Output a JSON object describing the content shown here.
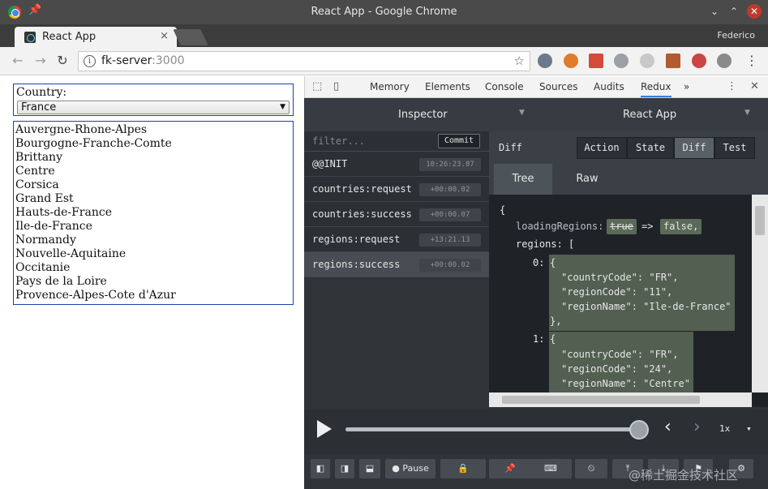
{
  "window": {
    "title": "React App - Google Chrome"
  },
  "browser": {
    "tab_label": "React App",
    "tab_close": "×",
    "profile_name": "Federico",
    "address": {
      "host": "fk-server",
      "port": ":3000"
    },
    "info_glyph": "i",
    "star_glyph": "☆"
  },
  "app": {
    "country_label": "Country:",
    "country_selected": "France",
    "regions": [
      "Auvergne-Rhone-Alpes",
      "Bourgogne-Franche-Comte",
      "Brittany",
      "Centre",
      "Corsica",
      "Grand Est",
      "Hauts-de-France",
      "Ile-de-France",
      "Normandy",
      "Nouvelle-Aquitaine",
      "Occitanie",
      "Pays de la Loire",
      "Provence-Alpes-Cote d'Azur"
    ]
  },
  "devtools": {
    "tabs": [
      "Memory",
      "Elements",
      "Console",
      "Sources",
      "Audits",
      "Redux"
    ],
    "active_tab": "Redux",
    "more": "»",
    "redux": {
      "left_header": "Inspector",
      "right_header": "React App",
      "filter_placeholder": "filter...",
      "commit_label": "Commit",
      "actions": [
        {
          "name": "@@INIT",
          "time": "10:26:23.87"
        },
        {
          "name": "countries:request",
          "time": "+00:00.02"
        },
        {
          "name": "countries:success",
          "time": "+00:00.07"
        },
        {
          "name": "regions:request",
          "time": "+13:21.13"
        },
        {
          "name": "regions:success",
          "time": "+00:00.02"
        }
      ],
      "selected_action": "regions:success",
      "panel_title": "Diff",
      "mode_buttons": [
        "Action",
        "State",
        "Diff",
        "Test"
      ],
      "active_mode": "Diff",
      "sub_tabs": [
        "Tree",
        "Raw"
      ],
      "active_sub_tab": "Tree",
      "diff": {
        "open_brace": "{",
        "loading_key": "loadingRegions:",
        "old_value": "true",
        "arrow": "=>",
        "new_value": "false,",
        "regions_key": "regions: [",
        "items": [
          {
            "index": "0:",
            "open": "{",
            "lines": [
              "\"countryCode\": \"FR\",",
              "\"regionCode\": \"11\",",
              "\"regionName\": \"Ile-de-France\""
            ],
            "close": "},"
          },
          {
            "index": "1:",
            "open": "{",
            "lines": [
              "\"countryCode\": \"FR\",",
              "\"regionCode\": \"24\",",
              "\"regionName\": \"Centre\""
            ]
          }
        ]
      },
      "player": {
        "speed": "1x",
        "progress": 1.0
      },
      "bottom": {
        "pause_label": "Pause"
      }
    }
  },
  "watermark": "@稀土掘金技术社区"
}
